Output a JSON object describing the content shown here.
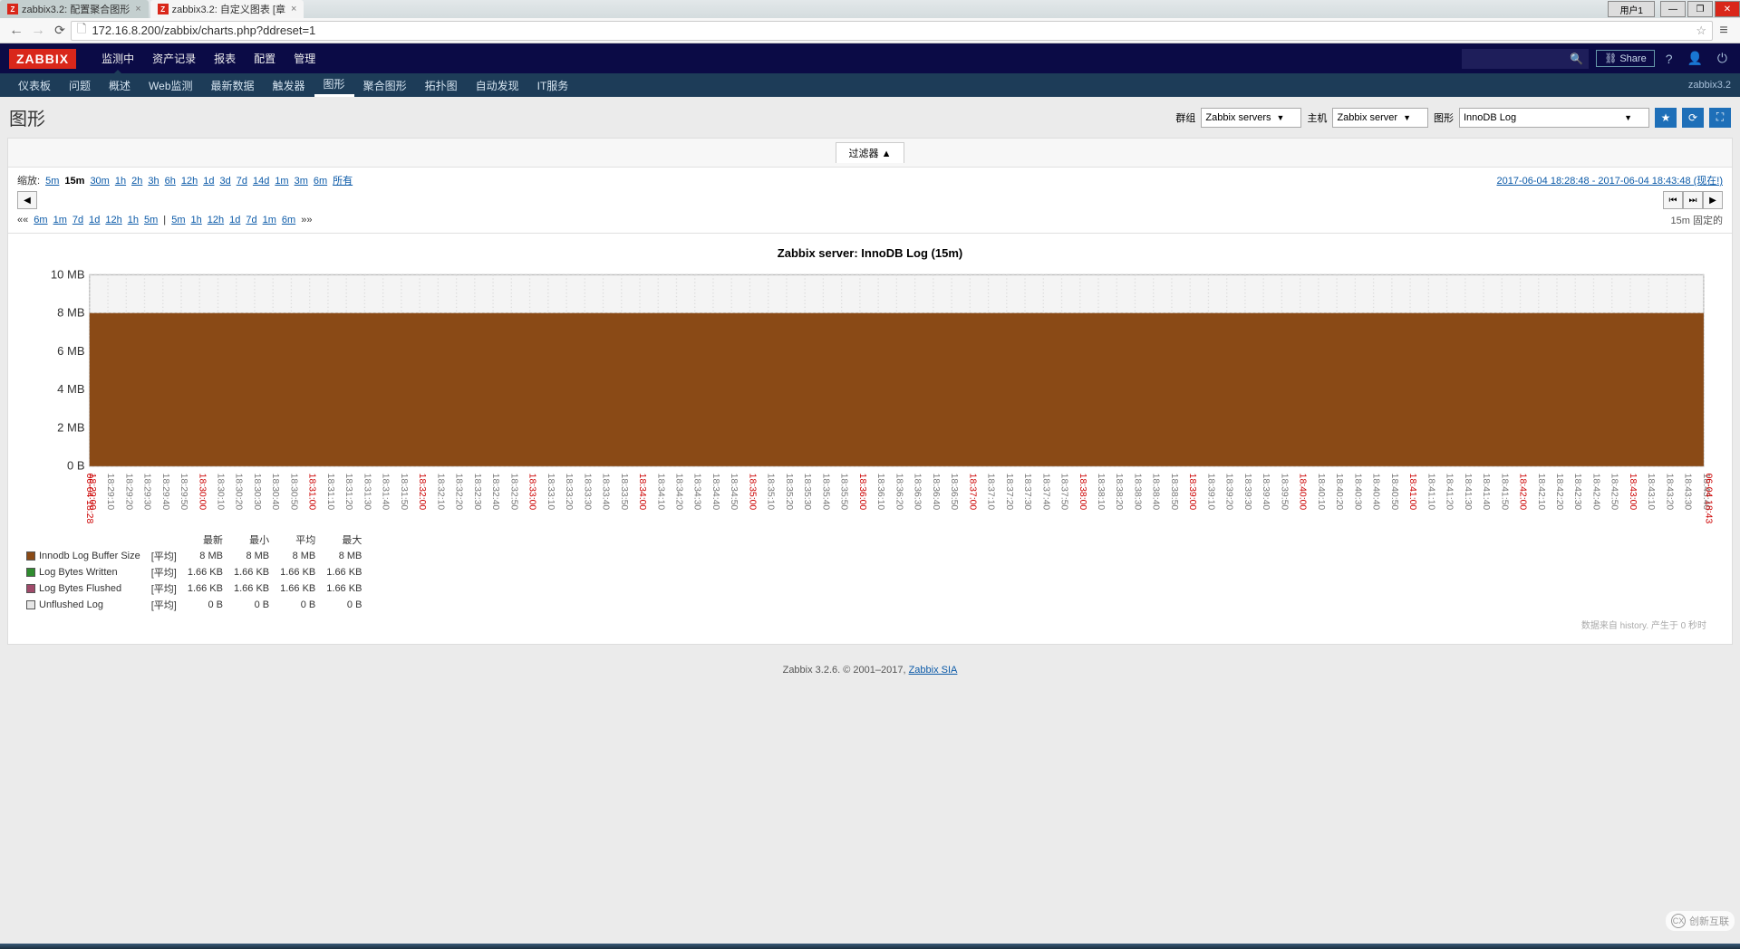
{
  "browser": {
    "tabs": [
      {
        "title": "zabbix3.2: 配置聚合图形",
        "active": false
      },
      {
        "title": "zabbix3.2: 自定义图表 [章",
        "active": true
      }
    ],
    "user_button": "用户1",
    "url": "172.16.8.200/zabbix/charts.php?ddreset=1"
  },
  "logo": "ZABBIX",
  "top_menu": [
    "监测中",
    "资产记录",
    "报表",
    "配置",
    "管理"
  ],
  "top_active": "监测中",
  "share_label": "Share",
  "sub_menu": [
    "仪表板",
    "问题",
    "概述",
    "Web监测",
    "最新数据",
    "触发器",
    "图形",
    "聚合图形",
    "拓扑图",
    "自动发现",
    "IT服务"
  ],
  "sub_active": "图形",
  "server_name": "zabbix3.2",
  "page_title": "图形",
  "selectors": {
    "group_label": "群组",
    "group_value": "Zabbix servers",
    "host_label": "主机",
    "host_value": "Zabbix server",
    "graph_label": "图形",
    "graph_value": "InnoDB Log"
  },
  "filter_tab": "过滤器 ▲",
  "zoom": {
    "label": "缩放:",
    "items": [
      "5m",
      "15m",
      "30m",
      "1h",
      "2h",
      "3h",
      "6h",
      "12h",
      "1d",
      "3d",
      "7d",
      "14d",
      "1m",
      "3m",
      "6m",
      "所有"
    ],
    "active": "15m",
    "range": "2017-06-04 18:28:48 - 2017-06-04 18:43:48 (现在!)",
    "nav_back": [
      "6m",
      "1m",
      "7d",
      "1d",
      "12h",
      "1h",
      "5m"
    ],
    "nav_fwd": [
      "5m",
      "1h",
      "12h",
      "1d",
      "7d",
      "1m",
      "6m"
    ],
    "fixed": "15m 固定的"
  },
  "chart_data": {
    "type": "area",
    "title": "Zabbix server: InnoDB Log (15m)",
    "ylabel": "",
    "y_ticks": [
      "0 B",
      "2 MB",
      "4 MB",
      "6 MB",
      "8 MB",
      "10 MB"
    ],
    "ylim": [
      0,
      10
    ],
    "x_start": "06-04 18:28",
    "x_end": "06-04 18:43",
    "x_minor_ticks": [
      "18:29:00",
      "18:29:10",
      "18:29:20",
      "18:29:30",
      "18:29:40",
      "18:29:50",
      "18:30:00",
      "18:30:10",
      "18:30:20",
      "18:30:30",
      "18:30:40",
      "18:30:50",
      "18:31:00",
      "18:31:10",
      "18:31:20",
      "18:31:30",
      "18:31:40",
      "18:31:50",
      "18:32:00",
      "18:32:10",
      "18:32:20",
      "18:32:30",
      "18:32:40",
      "18:32:50",
      "18:33:00",
      "18:33:10",
      "18:33:20",
      "18:33:30",
      "18:33:40",
      "18:33:50",
      "18:34:00",
      "18:34:10",
      "18:34:20",
      "18:34:30",
      "18:34:40",
      "18:34:50",
      "18:35:00",
      "18:35:10",
      "18:35:20",
      "18:35:30",
      "18:35:40",
      "18:35:50",
      "18:36:00",
      "18:36:10",
      "18:36:20",
      "18:36:30",
      "18:36:40",
      "18:36:50",
      "18:37:00",
      "18:37:10",
      "18:37:20",
      "18:37:30",
      "18:37:40",
      "18:37:50",
      "18:38:00",
      "18:38:10",
      "18:38:20",
      "18:38:30",
      "18:38:40",
      "18:38:50",
      "18:39:00",
      "18:39:10",
      "18:39:20",
      "18:39:30",
      "18:39:40",
      "18:39:50",
      "18:40:00",
      "18:40:10",
      "18:40:20",
      "18:40:30",
      "18:40:40",
      "18:40:50",
      "18:41:00",
      "18:41:10",
      "18:41:20",
      "18:41:30",
      "18:41:40",
      "18:41:50",
      "18:42:00",
      "18:42:10",
      "18:42:20",
      "18:42:30",
      "18:42:40",
      "18:42:50",
      "18:43:00",
      "18:43:10",
      "18:43:20",
      "18:43:30",
      "18:43:40"
    ],
    "x_major_every_seconds": 60,
    "series": [
      {
        "name": "Innodb Log Buffer Size",
        "color": "#8a4a16",
        "constant_value_mb": 8
      },
      {
        "name": "Log Bytes Written",
        "color": "#2e8b2e",
        "constant_value_kb": 1.66
      },
      {
        "name": "Log Bytes Flushed",
        "color": "#a04a6a",
        "constant_value_kb": 1.66
      },
      {
        "name": "Unflushed Log",
        "color": "#e6e6e6",
        "constant_value_b": 0
      }
    ],
    "legend": {
      "func": "[平均]",
      "headers": [
        "最新",
        "最小",
        "平均",
        "最大"
      ],
      "rows": [
        {
          "name": "Innodb Log Buffer Size",
          "color": "#8a4a16",
          "vals": [
            "8 MB",
            "8 MB",
            "8 MB",
            "8 MB"
          ]
        },
        {
          "name": "Log Bytes Written",
          "color": "#2e8b2e",
          "vals": [
            "1.66 KB",
            "1.66 KB",
            "1.66 KB",
            "1.66 KB"
          ]
        },
        {
          "name": "Log Bytes Flushed",
          "color": "#a04a6a",
          "vals": [
            "1.66 KB",
            "1.66 KB",
            "1.66 KB",
            "1.66 KB"
          ]
        },
        {
          "name": "Unflushed Log",
          "color": "#e6e6e6",
          "vals": [
            "0 B",
            "0 B",
            "0 B",
            "0 B"
          ]
        }
      ]
    },
    "footer_note": "数据来自 history. 产生于 0 秒时"
  },
  "footer": {
    "text": "Zabbix 3.2.6. © 2001–2017, ",
    "link": "Zabbix SIA"
  },
  "watermark": "创新互联"
}
